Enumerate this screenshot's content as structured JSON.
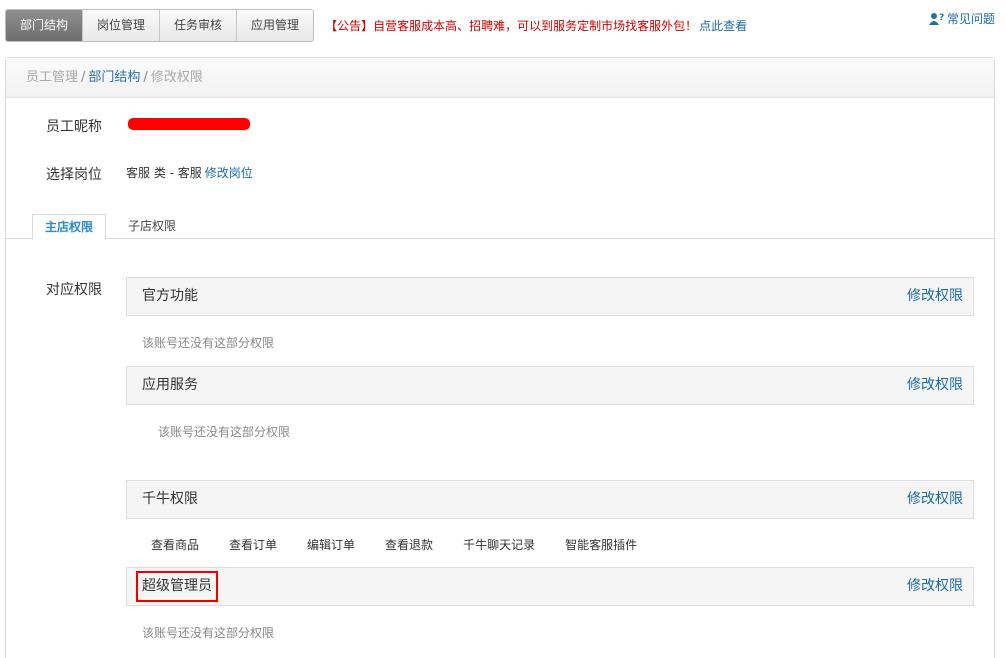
{
  "top_tabs": [
    {
      "label": "部门结构",
      "active": true
    },
    {
      "label": "岗位管理",
      "active": false
    },
    {
      "label": "任务审核",
      "active": false
    },
    {
      "label": "应用管理",
      "active": false
    }
  ],
  "notice": {
    "text": "【公告】自营客服成本高、招聘难，可以到服务定制市场找客服外包！",
    "link": "点此查看"
  },
  "help": {
    "label": "常见问题",
    "icon": "user-question-icon"
  },
  "breadcrumb": {
    "items": [
      "员工管理",
      "部门结构",
      "修改权限"
    ],
    "separator": "/"
  },
  "form": {
    "nickname_label": "员工昵称",
    "post_label": "选择岗位",
    "post_value": "客服 类 - 客服",
    "post_edit": "修改岗位",
    "perm_label": "对应权限"
  },
  "subtabs": [
    {
      "label": "主店权限",
      "active": true
    },
    {
      "label": "子店权限",
      "active": false
    }
  ],
  "sections": [
    {
      "title": "官方功能",
      "edit": "修改权限",
      "note": "该账号还没有这部分权限"
    },
    {
      "title": "应用服务",
      "edit": "修改权限",
      "note": "该账号还没有这部分权限"
    },
    {
      "title": "千牛权限",
      "edit": "修改权限",
      "perms": [
        "查看商品",
        "查看订单",
        "编辑订单",
        "查看退款",
        "千牛聊天记录",
        "智能客服插件"
      ]
    },
    {
      "title": "超级管理员",
      "edit": "修改权限",
      "note": "该账号还没有这部分权限"
    }
  ],
  "colors": {
    "link": "#1a6aa8",
    "notice": "#d40000",
    "redaction": "#ff0000",
    "highlight_box": "#ee0000",
    "active_subtab": "#2a8ad6"
  }
}
